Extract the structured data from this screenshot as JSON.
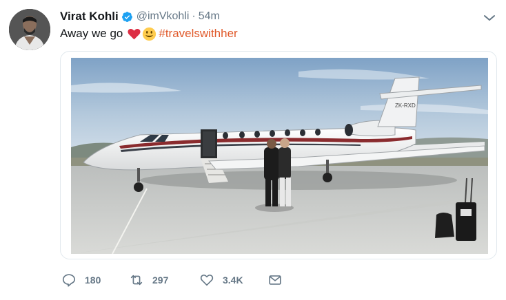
{
  "author": {
    "name": "Virat Kohli",
    "handle": "@imVkohli",
    "separator": "·",
    "time": "54m"
  },
  "tweet": {
    "text": "Away we go",
    "hashtag": "#travelswithher",
    "emojis": [
      "red-heart-emoji",
      "smiley-face-emoji"
    ]
  },
  "media": {
    "aircraft_registration": "ZK-RXD"
  },
  "actions": {
    "reply_count": "180",
    "retweet_count": "297",
    "like_count": "3.4K"
  },
  "colors": {
    "hashtag": "#e0592a",
    "verified": "#1da1f2",
    "muted": "#657786",
    "border": "#e1e8ed"
  }
}
